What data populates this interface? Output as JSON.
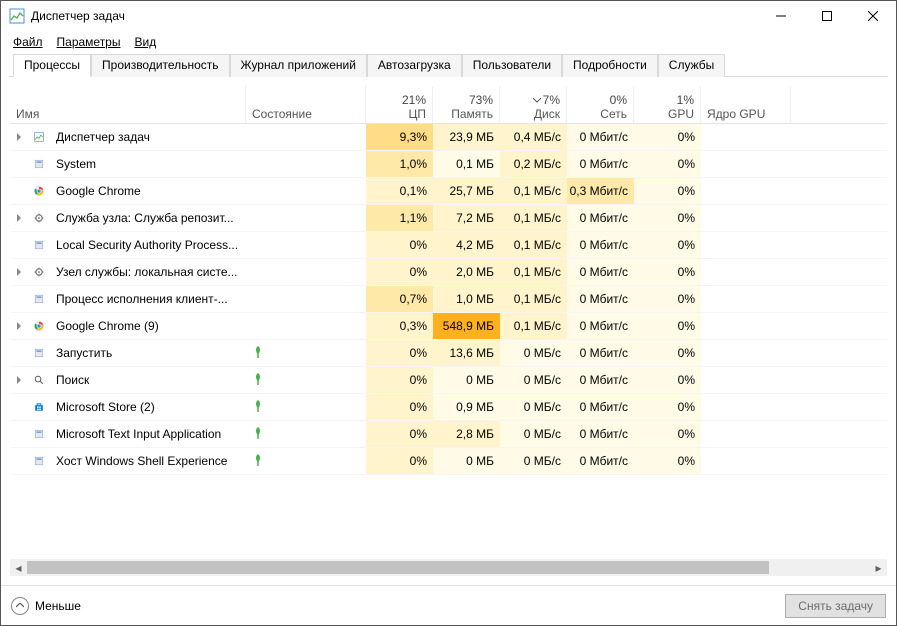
{
  "window": {
    "title": "Диспетчер задач"
  },
  "menu": {
    "file": "Файл",
    "options": "Параметры",
    "view": "Вид"
  },
  "tabs": [
    {
      "label": "Процессы",
      "active": true
    },
    {
      "label": "Производительность",
      "active": false
    },
    {
      "label": "Журнал приложений",
      "active": false
    },
    {
      "label": "Автозагрузка",
      "active": false
    },
    {
      "label": "Пользователи",
      "active": false
    },
    {
      "label": "Подробности",
      "active": false
    },
    {
      "label": "Службы",
      "active": false
    }
  ],
  "columns": {
    "name": "Имя",
    "state": "Состояние",
    "cpu": {
      "pct": "21%",
      "label": "ЦП"
    },
    "mem": {
      "pct": "73%",
      "label": "Память"
    },
    "disk": {
      "pct": "7%",
      "label": "Диск",
      "sorted": true
    },
    "net": {
      "pct": "0%",
      "label": "Сеть"
    },
    "gpu": {
      "pct": "1%",
      "label": "GPU"
    },
    "gpucore": "Ядро GPU"
  },
  "processes": [
    {
      "expand": true,
      "icon": "taskmgr",
      "name": "Диспетчер задач",
      "cpu": "9,3%",
      "mem": "23,9 МБ",
      "disk": "0,4 МБ/с",
      "net": "0 Мбит/с",
      "gpu": "0%",
      "cpu_h": 3,
      "mem_h": 1,
      "disk_h": 1,
      "net_h": 0,
      "gpu_h": 0
    },
    {
      "expand": false,
      "icon": "system",
      "name": "System",
      "cpu": "1,0%",
      "mem": "0,1 МБ",
      "disk": "0,2 МБ/с",
      "net": "0 Мбит/с",
      "gpu": "0%",
      "cpu_h": 2,
      "mem_h": 0,
      "disk_h": 1,
      "net_h": 0,
      "gpu_h": 0
    },
    {
      "expand": false,
      "icon": "chrome",
      "name": "Google Chrome",
      "cpu": "0,1%",
      "mem": "25,7 МБ",
      "disk": "0,1 МБ/с",
      "net": "0,3 Мбит/с",
      "gpu": "0%",
      "cpu_h": 1,
      "mem_h": 1,
      "disk_h": 1,
      "net_h": 2,
      "gpu_h": 0
    },
    {
      "expand": true,
      "icon": "service",
      "name": "Служба узла: Служба репозит...",
      "cpu": "1,1%",
      "mem": "7,2 МБ",
      "disk": "0,1 МБ/с",
      "net": "0 Мбит/с",
      "gpu": "0%",
      "cpu_h": 2,
      "mem_h": 1,
      "disk_h": 1,
      "net_h": 0,
      "gpu_h": 0
    },
    {
      "expand": false,
      "icon": "system",
      "name": "Local Security Authority Process...",
      "cpu": "0%",
      "mem": "4,2 МБ",
      "disk": "0,1 МБ/с",
      "net": "0 Мбит/с",
      "gpu": "0%",
      "cpu_h": 1,
      "mem_h": 1,
      "disk_h": 1,
      "net_h": 0,
      "gpu_h": 0
    },
    {
      "expand": true,
      "icon": "service",
      "name": "Узел службы: локальная систе...",
      "cpu": "0%",
      "mem": "2,0 МБ",
      "disk": "0,1 МБ/с",
      "net": "0 Мбит/с",
      "gpu": "0%",
      "cpu_h": 1,
      "mem_h": 1,
      "disk_h": 1,
      "net_h": 0,
      "gpu_h": 0
    },
    {
      "expand": false,
      "icon": "system",
      "name": "Процесс исполнения клиент-...",
      "cpu": "0,7%",
      "mem": "1,0 МБ",
      "disk": "0,1 МБ/с",
      "net": "0 Мбит/с",
      "gpu": "0%",
      "cpu_h": 2,
      "mem_h": 1,
      "disk_h": 1,
      "net_h": 0,
      "gpu_h": 0
    },
    {
      "expand": true,
      "icon": "chrome",
      "name": "Google Chrome (9)",
      "cpu": "0,3%",
      "mem": "548,9 МБ",
      "disk": "0,1 МБ/с",
      "net": "0 Мбит/с",
      "gpu": "0%",
      "cpu_h": 1,
      "mem_h": 5,
      "disk_h": 1,
      "net_h": 0,
      "gpu_h": 0
    },
    {
      "expand": false,
      "icon": "system",
      "name": "Запустить",
      "leaf": true,
      "cpu": "0%",
      "mem": "13,6 МБ",
      "disk": "0 МБ/с",
      "net": "0 Мбит/с",
      "gpu": "0%",
      "cpu_h": 1,
      "mem_h": 1,
      "disk_h": 0,
      "net_h": 0,
      "gpu_h": 0
    },
    {
      "expand": true,
      "icon": "search",
      "name": "Поиск",
      "leaf": true,
      "cpu": "0%",
      "mem": "0 МБ",
      "disk": "0 МБ/с",
      "net": "0 Мбит/с",
      "gpu": "0%",
      "cpu_h": 1,
      "mem_h": 0,
      "disk_h": 0,
      "net_h": 0,
      "gpu_h": 0
    },
    {
      "expand": false,
      "icon": "store",
      "name": "Microsoft Store (2)",
      "leaf": true,
      "cpu": "0%",
      "mem": "0,9 МБ",
      "disk": "0 МБ/с",
      "net": "0 Мбит/с",
      "gpu": "0%",
      "cpu_h": 1,
      "mem_h": 0,
      "disk_h": 0,
      "net_h": 0,
      "gpu_h": 0
    },
    {
      "expand": false,
      "icon": "system",
      "name": "Microsoft Text Input Application",
      "leaf": true,
      "cpu": "0%",
      "mem": "2,8 МБ",
      "disk": "0 МБ/с",
      "net": "0 Мбит/с",
      "gpu": "0%",
      "cpu_h": 1,
      "mem_h": 1,
      "disk_h": 0,
      "net_h": 0,
      "gpu_h": 0
    },
    {
      "expand": false,
      "icon": "system",
      "name": "Хост Windows Shell Experience",
      "leaf": true,
      "cpu": "0%",
      "mem": "0 МБ",
      "disk": "0 МБ/с",
      "net": "0 Мбит/с",
      "gpu": "0%",
      "cpu_h": 1,
      "mem_h": 0,
      "disk_h": 0,
      "net_h": 0,
      "gpu_h": 0
    }
  ],
  "footer": {
    "fewer": "Меньше",
    "end_task": "Снять задачу"
  }
}
